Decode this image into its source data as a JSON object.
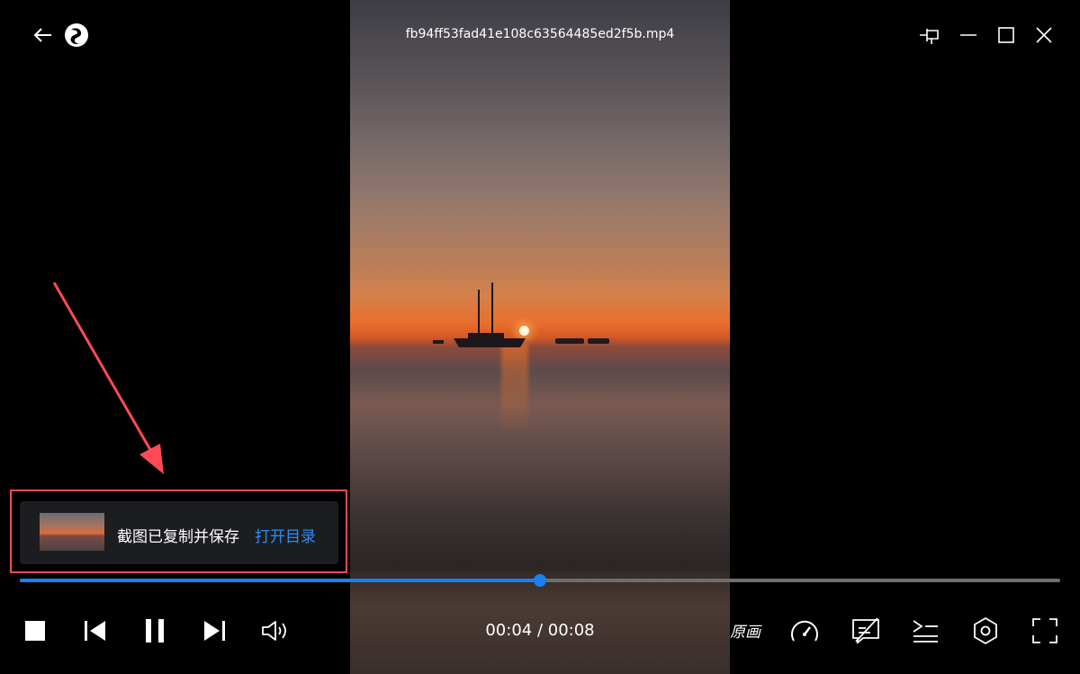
{
  "window": {
    "title": "fb94ff53fad41e108c63564485ed2f5b.mp4"
  },
  "toast": {
    "message": "截图已复制并保存",
    "link": "打开目录"
  },
  "playback": {
    "current": "00:04",
    "duration": "00:08",
    "time_display": "00:04 / 00:08",
    "progress_fraction": 0.5
  },
  "controls": {
    "quality_label": "原画"
  },
  "icons": {
    "back": "back-arrow-icon",
    "logo": "app-logo-icon",
    "pin": "pin-icon",
    "minimize": "minimize-icon",
    "maximize": "maximize-icon",
    "close": "close-icon",
    "stop": "stop-icon",
    "prev": "previous-icon",
    "pause": "pause-icon",
    "next": "next-icon",
    "volume": "volume-icon",
    "speed": "speed-gauge-icon",
    "subtitle": "subtitle-off-icon",
    "playlist": "playlist-icon",
    "settings": "settings-icon",
    "fullscreen": "fullscreen-icon"
  },
  "colors": {
    "accent": "#1a7ff0",
    "annotation": "#ff4a55",
    "toast_bg": "#1c1d20"
  }
}
